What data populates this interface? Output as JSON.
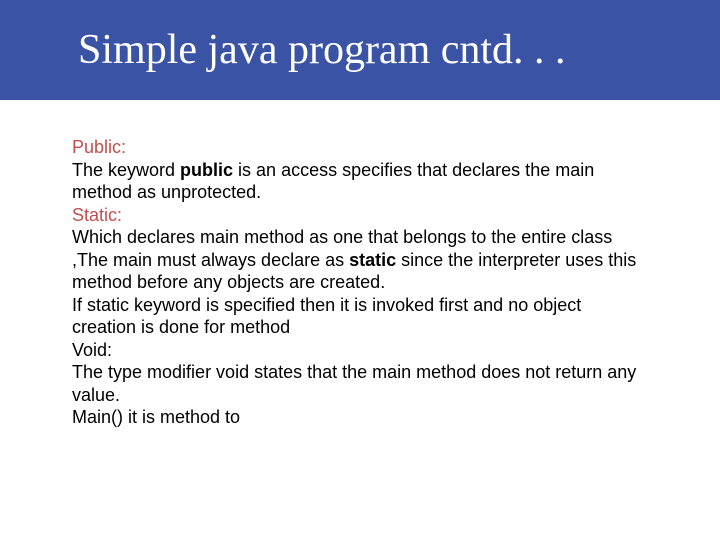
{
  "header": {
    "title": "Simple java program cntd. . ."
  },
  "content": {
    "public_label": "Public:",
    "public_text1": "The  keyword ",
    "public_bold": "public",
    "public_text2": " is an access specifies that declares the main method as unprotected.",
    "static_label": "Static:",
    "static_text1": "Which declares main method as one that belongs to the entire class ,The main must always declare as ",
    "static_bold": "static",
    "static_text2": " since the interpreter uses this method before any objects are created.",
    "static_text3": "If static keyword is specified then it is invoked first and no object creation is done for method",
    "void_label": "Void:",
    "void_text": "The type modifier void states that the main method does not return any value.",
    "main_text": "Main() it is method to"
  }
}
